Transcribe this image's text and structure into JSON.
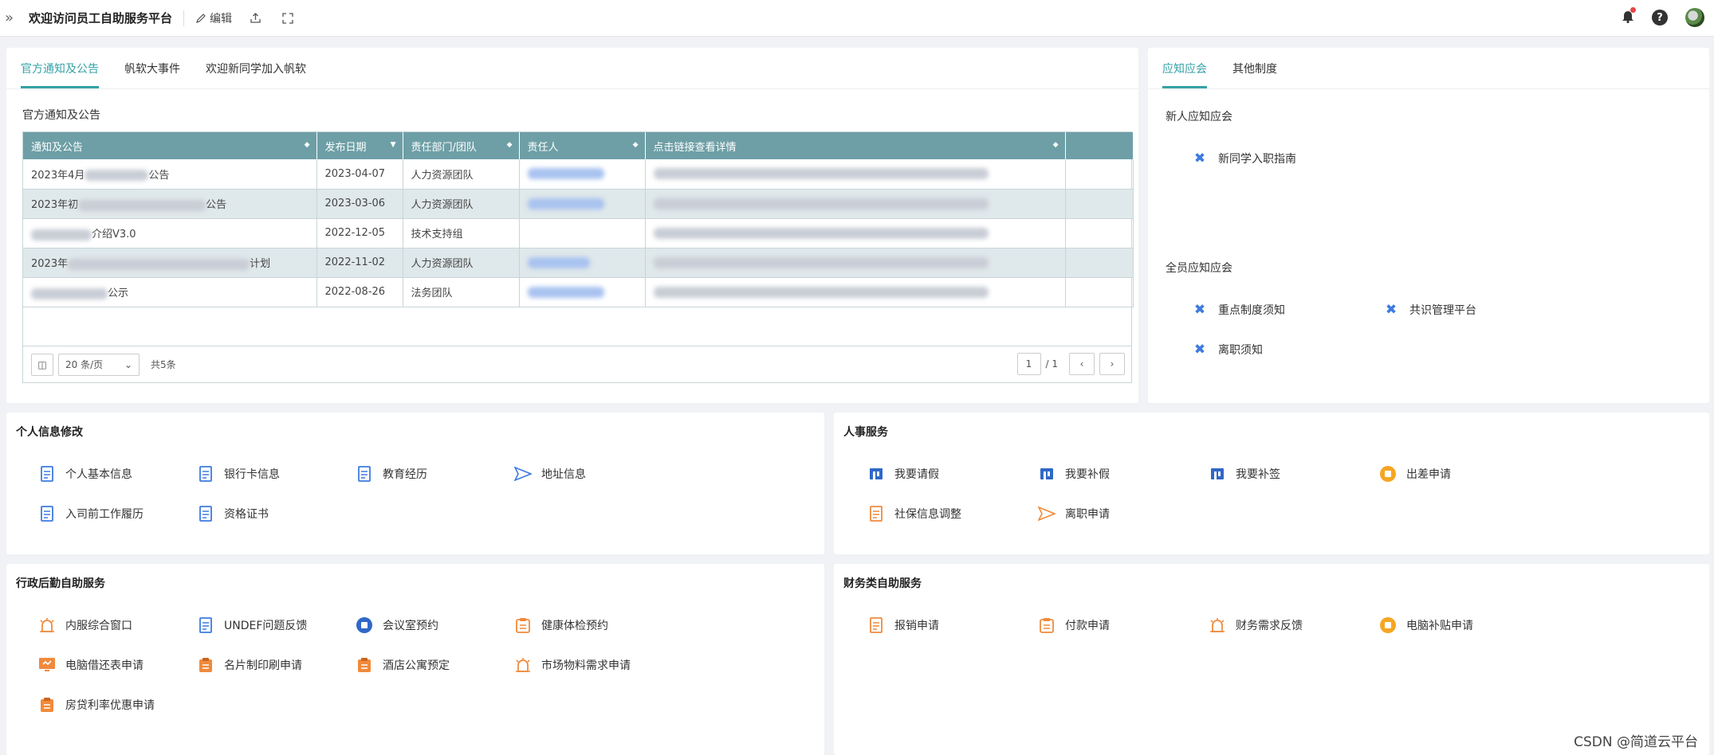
{
  "topbar": {
    "title": "欢迎访问员工自助服务平台",
    "edit": "编辑"
  },
  "notices": {
    "tabs": [
      "官方通知及公告",
      "帆软大事件",
      "欢迎新同学加入帆软"
    ],
    "section": "官方通知及公告",
    "headers": [
      "通知及公告",
      "发布日期",
      "责任部门/团队",
      "责任人",
      "点击链接查看详情"
    ],
    "rows": [
      {
        "prefix": "2023年4月",
        "suffix": "公告",
        "date": "2023-04-07",
        "dept": "人力资源团队"
      },
      {
        "prefix": "2023年初",
        "suffix": "公告",
        "date": "2023-03-06",
        "dept": "人力资源团队"
      },
      {
        "prefix": "",
        "suffix": "介绍V3.0",
        "date": "2022-12-05",
        "dept": "技术支持组"
      },
      {
        "prefix": "2023年",
        "suffix": "计划",
        "date": "2022-11-02",
        "dept": "人力资源团队"
      },
      {
        "prefix": "",
        "suffix": "公示",
        "date": "2022-08-26",
        "dept": "法务团队"
      }
    ],
    "pagesize": "20 条/页",
    "total": "共5条",
    "page": "1",
    "pages": "/ 1"
  },
  "rules": {
    "tabs": [
      "应知应会",
      "其他制度"
    ],
    "new_title": "新人应知应会",
    "new_items": [
      "新同学入职指南"
    ],
    "all_title": "全员应知应会",
    "all_items": [
      "重点制度须知",
      "共识管理平台",
      "离职须知"
    ]
  },
  "personal": {
    "title": "个人信息修改",
    "items": [
      "个人基本信息",
      "银行卡信息",
      "教育经历",
      "地址信息",
      "入司前工作履历",
      "资格证书"
    ]
  },
  "hr": {
    "title": "人事服务",
    "items": [
      "我要请假",
      "我要补假",
      "我要补签",
      "出差申请",
      "社保信息调整",
      "离职申请"
    ]
  },
  "admin": {
    "title": "行政后勤自助服务",
    "items": [
      "内服综合窗口",
      "UNDEF问题反馈",
      "会议室预约",
      "健康体检预约",
      "电脑借还表申请",
      "名片制印刷申请",
      "酒店公寓预定",
      "市场物料需求申请",
      "房贷利率优惠申请"
    ]
  },
  "finance": {
    "title": "财务类自助服务",
    "items": [
      "报销申请",
      "付款申请",
      "财务需求反馈",
      "电脑补贴申请"
    ]
  },
  "watermark": "CSDN @简道云平台",
  "colors": {
    "accent": "#36a2a6",
    "header": "#6e9fa6",
    "blue": "#3d7be0",
    "orange": "#f08a3c"
  }
}
